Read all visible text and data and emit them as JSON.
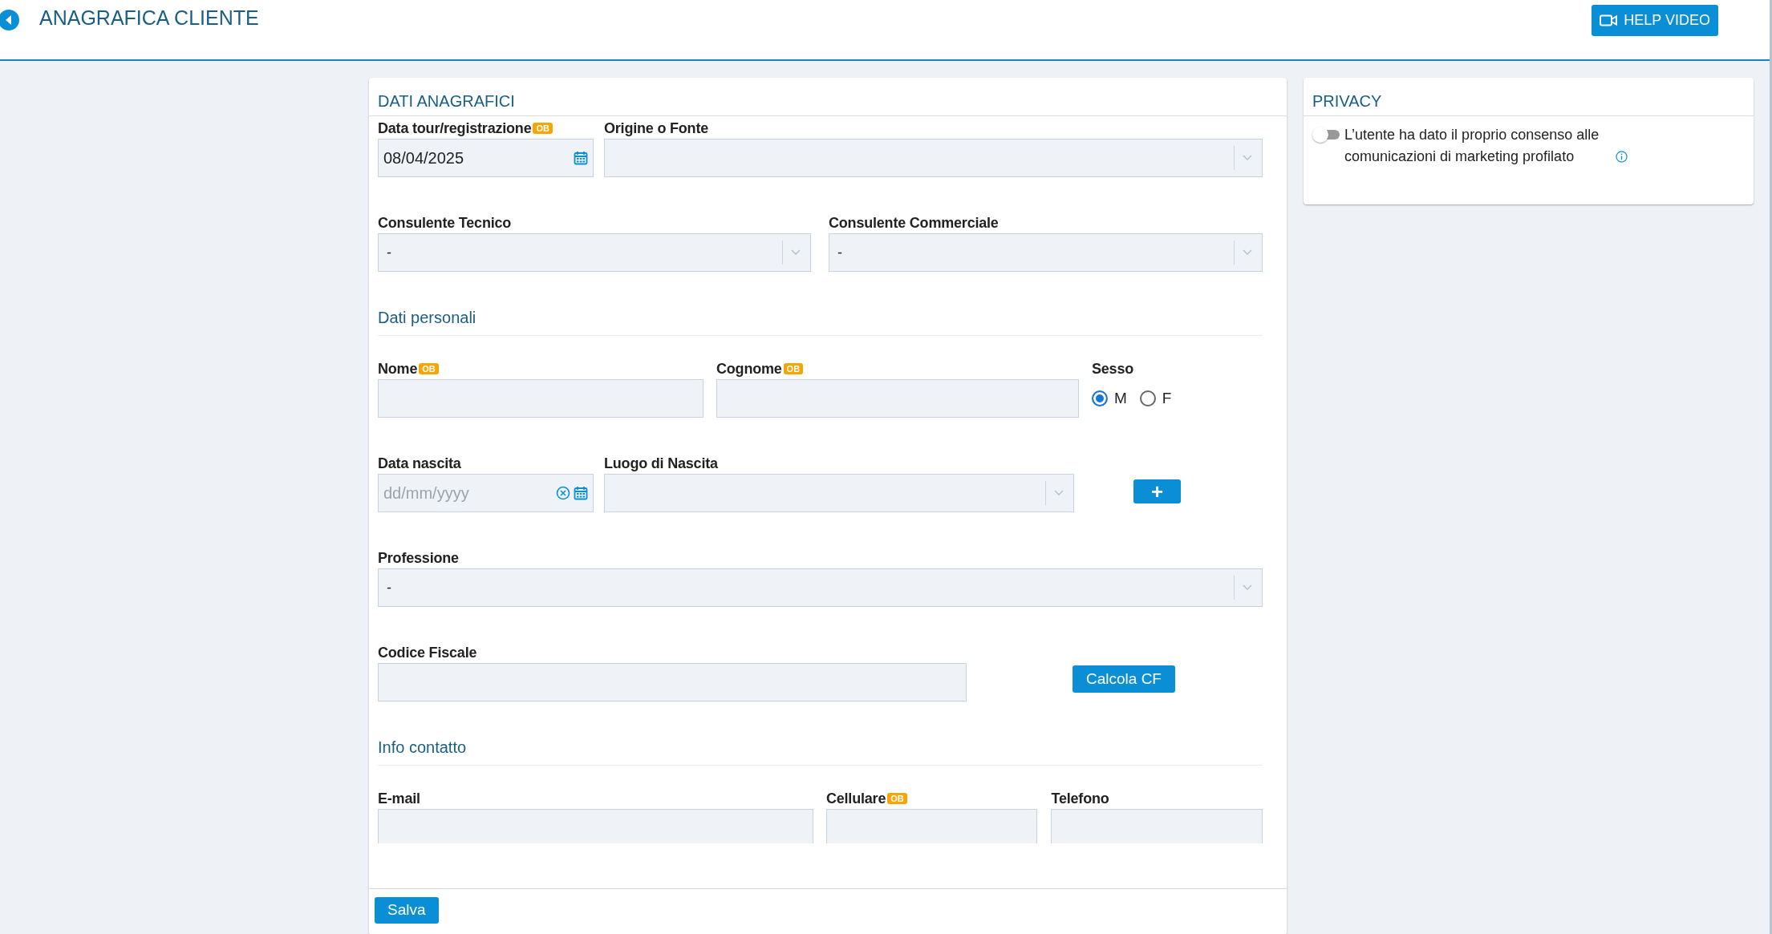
{
  "header": {
    "title": "ANAGRAFICA CLIENTE",
    "help_button": "HELP VIDEO"
  },
  "main_card": {
    "title": "DATI ANAGRAFICI",
    "sections": [
      {
        "lines": [
          [
            {
              "kind": "date",
              "label": "Data tour/registrazione",
              "badge": "OB",
              "value": "08/04/2025",
              "clearable": false
            },
            {
              "kind": "select",
              "label": "Origine o Fonte"
            }
          ],
          [
            {
              "kind": "select",
              "label": "Consulente Tecnico",
              "value": "-"
            },
            {
              "kind": "select",
              "label": "Consulente Commerciale",
              "value": "-"
            }
          ]
        ]
      },
      {
        "heading": "Dati personali",
        "lines": [
          [
            {
              "kind": "text",
              "label": "Nome",
              "badge": "OB"
            },
            {
              "kind": "text",
              "label": "Cognome",
              "badge": "OB"
            },
            {
              "kind": "radio",
              "label": "Sesso",
              "options": [
                {
                  "label": "M",
                  "selected": true
                },
                {
                  "label": "F",
                  "selected": false
                }
              ]
            }
          ],
          [
            {
              "kind": "date",
              "label": "Data nascita",
              "placeholder": "dd/mm/yyyy",
              "clearable": true
            },
            {
              "kind": "select",
              "label": "Luogo di Nascita"
            },
            {
              "kind": "button",
              "text": "+"
            }
          ],
          [
            {
              "kind": "select",
              "label": "Professione",
              "value": "-"
            }
          ],
          [
            {
              "kind": "text",
              "label": "Codice Fiscale"
            },
            {
              "kind": "button",
              "text": "Calcola CF"
            }
          ]
        ]
      },
      {
        "heading": "Info contatto",
        "lines": [
          [
            {
              "kind": "text",
              "label": "E-mail"
            },
            {
              "kind": "text",
              "label": "Cellulare",
              "badge": "OB"
            },
            {
              "kind": "text",
              "label": "Telefono"
            }
          ]
        ]
      }
    ],
    "save_button": "Salva"
  },
  "privacy": {
    "title": "PRIVACY",
    "consent": {
      "on": false,
      "text": "L’utente ha dato il proprio consenso alle comunicazioni di marketing profilato"
    }
  }
}
